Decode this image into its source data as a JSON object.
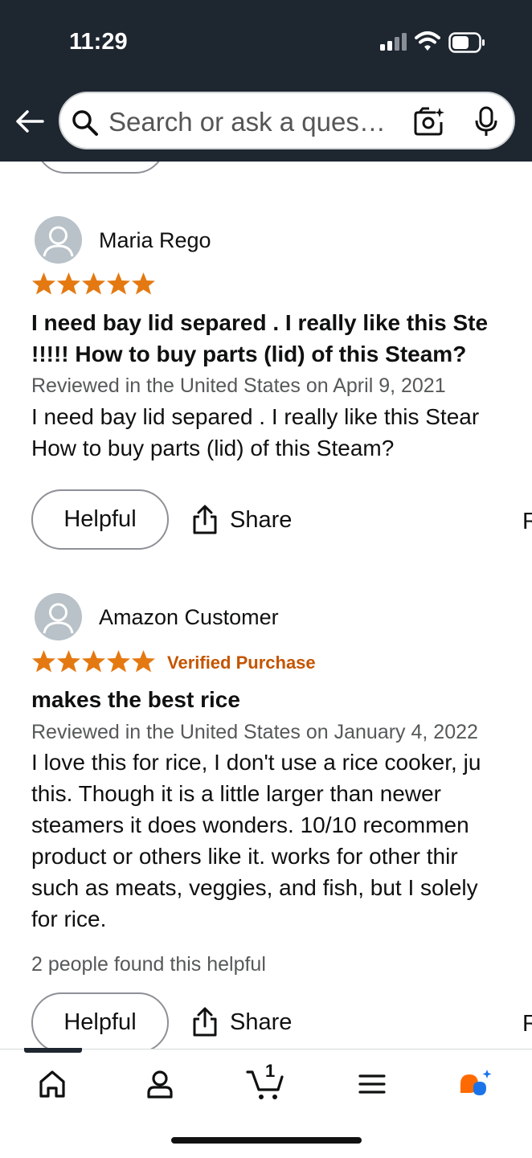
{
  "status_bar": {
    "time": "11:29"
  },
  "search": {
    "placeholder": "Search or ask a ques…"
  },
  "reviews": [
    {
      "reviewer": "Maria Rego",
      "rating": 5,
      "verified": "",
      "title_lines": [
        "I need bay lid separed . I really like this Ste",
        "!!!!! How to buy parts (lid) of this Steam?"
      ],
      "date": "Reviewed in the United States on April 9, 2021",
      "body_lines": [
        "I need bay lid separed . I really like this Stear",
        "How to buy parts (lid) of this Steam?"
      ],
      "helpful_count": "",
      "helpful_label": "Helpful",
      "share_label": "Share",
      "report_stub": "R"
    },
    {
      "reviewer": "Amazon Customer",
      "rating": 5,
      "verified": "Verified Purchase",
      "title_lines": [
        "makes the best rice"
      ],
      "date": "Reviewed in the United States on January 4, 2022",
      "body_lines": [
        "I love this for rice, I don't use a rice cooker, ju",
        "this. Though it is a little larger than newer",
        "steamers it does wonders. 10/10 recommen",
        "product or others like it. works for other thir",
        "such as meats, veggies, and fish, but I solely",
        "for rice."
      ],
      "helpful_count": "2 people found this helpful",
      "helpful_label": "Helpful",
      "share_label": "Share",
      "report_stub": "R"
    }
  ],
  "bottom_nav": {
    "items": [
      "home-icon",
      "account-icon",
      "cart-icon",
      "menu-icon",
      "rufus-icon"
    ],
    "cart_count": "1"
  },
  "colors": {
    "star": "#e47911",
    "verified": "#c45500",
    "topbar": "#1e2630"
  }
}
